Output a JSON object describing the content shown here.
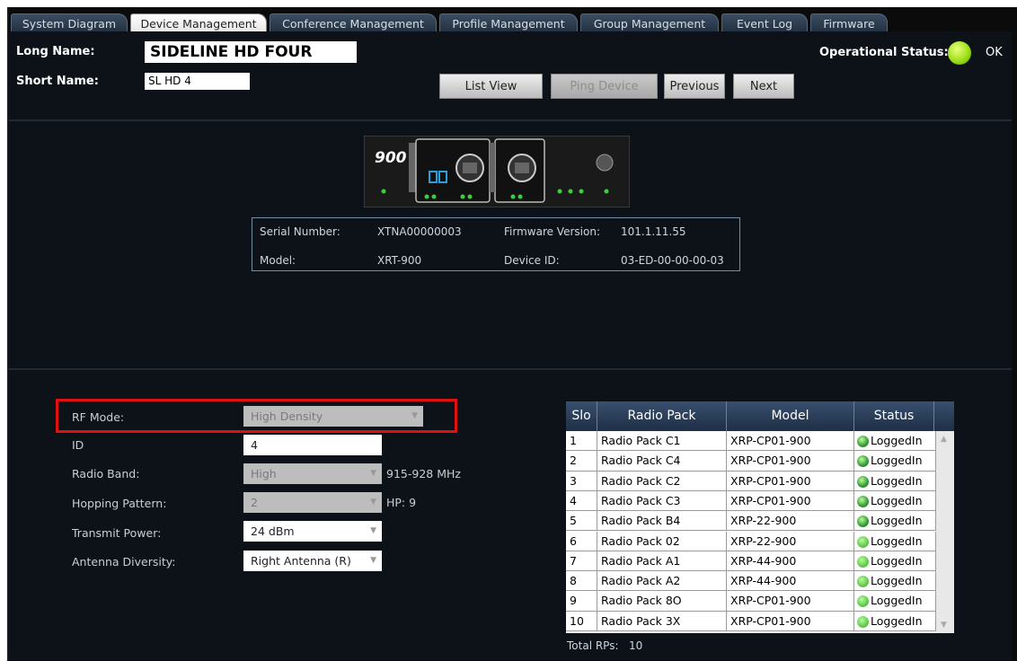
{
  "tabs": [
    {
      "label": "System Diagram",
      "active": false
    },
    {
      "label": "Device Management",
      "active": true
    },
    {
      "label": "Conference Management",
      "active": false
    },
    {
      "label": "Profile Management",
      "active": false
    },
    {
      "label": "Group Management",
      "active": false
    },
    {
      "label": "Event Log",
      "active": false
    },
    {
      "label": "Firmware",
      "active": false
    }
  ],
  "header": {
    "long_name_label": "Long Name:",
    "long_name_value": "SIDELINE HD FOUR",
    "short_name_label": "Short Name:",
    "short_name_value": "SL HD 4",
    "operational_status_label": "Operational Status:",
    "operational_status_value": "OK"
  },
  "buttons": {
    "list_view": "List View",
    "ping_device": "Ping Device",
    "previous": "Previous",
    "next": "Next"
  },
  "device_panel": {
    "model_badge": "900",
    "icon": "device-front-panel-icon"
  },
  "info": {
    "serial_label": "Serial Number:",
    "serial_value": "XTNA00000003",
    "firmware_label": "Firmware Version:",
    "firmware_value": "101.1.11.55",
    "model_label": "Model:",
    "model_value": "XRT-900",
    "device_id_label": "Device ID:",
    "device_id_value": "03-ED-00-00-00-03"
  },
  "settings": {
    "rf_mode_label": "RF Mode:",
    "rf_mode_value": "High Density",
    "id_label": "ID",
    "id_value": "4",
    "radio_band_label": "Radio Band:",
    "radio_band_value": "High",
    "radio_band_suffix": "915-928 MHz",
    "hopping_label": "Hopping Pattern:",
    "hopping_value": "2",
    "hopping_suffix": "HP: 9",
    "transmit_label": "Transmit Power:",
    "transmit_value": "24 dBm",
    "antenna_label": "Antenna Diversity:",
    "antenna_value": "Right Antenna (R)"
  },
  "radio_table": {
    "headers": [
      "Slo",
      "Radio Pack",
      "Model",
      "Status"
    ],
    "rows": [
      {
        "slot": "1",
        "pack": "Radio Pack C1",
        "model": "XRP-CP01-900",
        "status": "LoggedIn",
        "led": "#2f8f2f"
      },
      {
        "slot": "2",
        "pack": "Radio Pack C4",
        "model": "XRP-CP01-900",
        "status": "LoggedIn",
        "led": "#2f8f2f"
      },
      {
        "slot": "3",
        "pack": "Radio Pack C2",
        "model": "XRP-CP01-900",
        "status": "LoggedIn",
        "led": "#2f8f2f"
      },
      {
        "slot": "4",
        "pack": "Radio Pack C3",
        "model": "XRP-CP01-900",
        "status": "LoggedIn",
        "led": "#2f8f2f"
      },
      {
        "slot": "5",
        "pack": "Radio Pack B4",
        "model": "XRP-22-900",
        "status": "LoggedIn",
        "led": "#2f8f2f"
      },
      {
        "slot": "6",
        "pack": "Radio Pack 02",
        "model": "XRP-22-900",
        "status": "LoggedIn",
        "led": "#5fc24a"
      },
      {
        "slot": "7",
        "pack": "Radio Pack A1",
        "model": "XRP-44-900",
        "status": "LoggedIn",
        "led": "#5fc24a"
      },
      {
        "slot": "8",
        "pack": "Radio Pack A2",
        "model": "XRP-44-900",
        "status": "LoggedIn",
        "led": "#5fc24a"
      },
      {
        "slot": "9",
        "pack": "Radio Pack 8O",
        "model": "XRP-CP01-900",
        "status": "LoggedIn",
        "led": "#5fc24a"
      },
      {
        "slot": "10",
        "pack": "Radio Pack 3X",
        "model": "XRP-CP01-900",
        "status": "LoggedIn",
        "led": "#5fc24a"
      }
    ],
    "total_label": "Total RPs:",
    "total_value": "10"
  },
  "colors": {
    "status_ok": "#9de01a",
    "highlight_box": "#e01010",
    "table_header": "#2a3d58"
  }
}
